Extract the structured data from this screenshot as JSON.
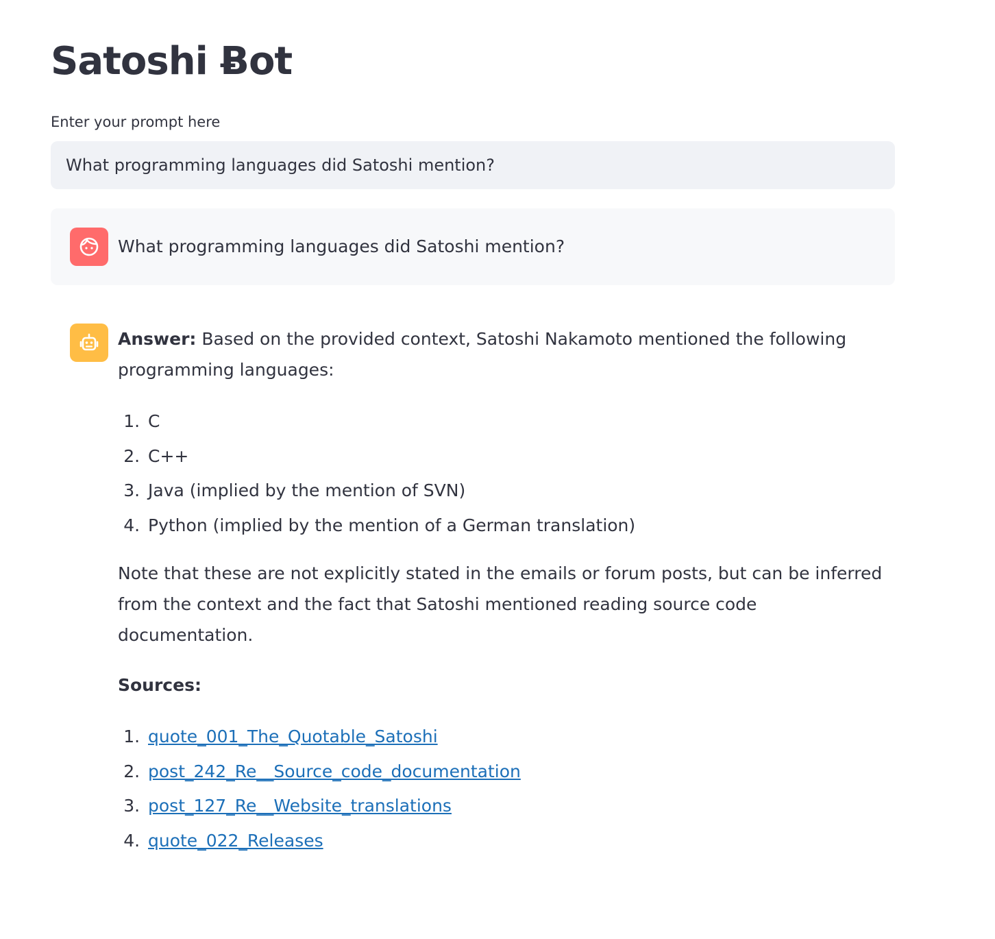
{
  "app": {
    "title": "Satoshi Ƀot"
  },
  "prompt": {
    "label": "Enter your prompt here",
    "value": "What programming languages did Satoshi mention?"
  },
  "user_message": {
    "avatar_icon": "user-face-icon",
    "text": "What programming languages did Satoshi mention?"
  },
  "bot_message": {
    "avatar_icon": "robot-icon",
    "answer_label": "Answer:",
    "answer_text": "Based on the provided context, Satoshi Nakamoto mentioned the following programming languages:",
    "languages": [
      "C",
      "C++",
      "Java (implied by the mention of SVN)",
      "Python (implied by the mention of a German translation)"
    ],
    "note": "Note that these are not explicitly stated in the emails or forum posts, but can be inferred from the context and the fact that Satoshi mentioned reading source code documentation.",
    "sources_label": "Sources:",
    "sources": [
      "quote_001_The_Quotable_Satoshi",
      "post_242_Re__Source_code_documentation",
      "post_127_Re__Website_translations",
      "quote_022_Releases"
    ]
  },
  "colors": {
    "user_avatar": "#ff6b6b",
    "bot_avatar": "#ffbd45",
    "link": "#1c6fb8",
    "input_bg": "#f0f2f6"
  }
}
